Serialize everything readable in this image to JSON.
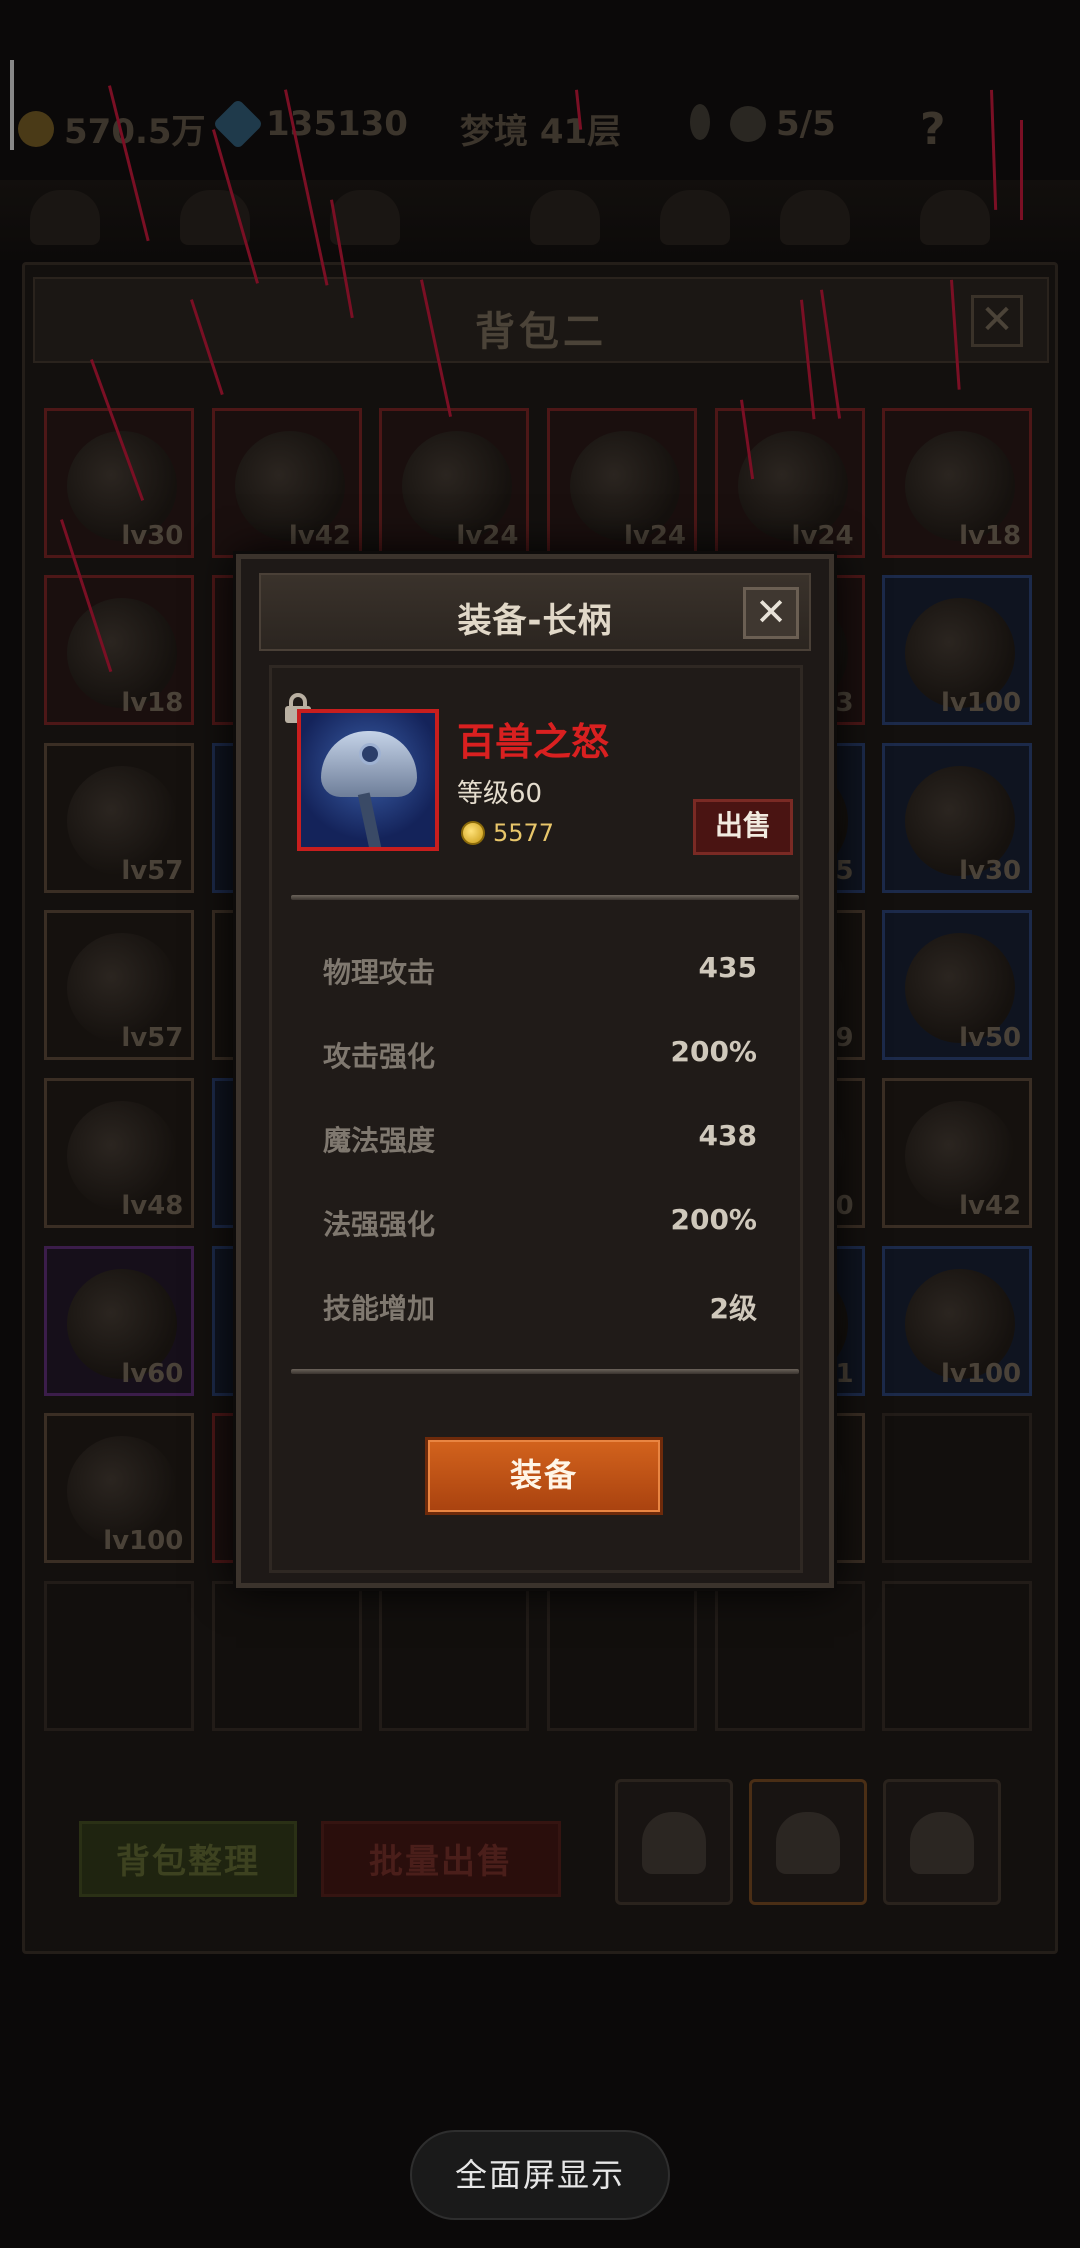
{
  "topbar": {
    "gold": "570.5万",
    "gems": "135130",
    "stage": "梦境 41层",
    "skulls": "5/5",
    "help": "?"
  },
  "bag": {
    "title": "背包二",
    "close": "✕",
    "slot_levels": [
      [
        "lv30",
        "lv42",
        "lv24",
        "lv24",
        "lv24",
        "lv18"
      ],
      [
        "lv18",
        "",
        "",
        "",
        "3",
        "lv100"
      ],
      [
        "lv57",
        "",
        "",
        "",
        "5",
        "lv30"
      ],
      [
        "lv57",
        "",
        "",
        "",
        "9",
        "lv50"
      ],
      [
        "lv48",
        "",
        "",
        "",
        "00",
        "lv42"
      ],
      [
        "lv60",
        "",
        "",
        "",
        "1",
        "lv100"
      ],
      [
        "lv100",
        "",
        "",
        "",
        "",
        ""
      ],
      [
        "",
        "",
        "",
        "",
        "",
        ""
      ]
    ],
    "sort_button": "背包整理",
    "bulk_sell_button": "批量出售"
  },
  "modal": {
    "title": "装备-长柄",
    "close": "✕",
    "item_name": "百兽之怒",
    "item_level": "等级60",
    "item_price": "5577",
    "sell_button": "出售",
    "stats": [
      {
        "label": "物理攻击",
        "value": "435"
      },
      {
        "label": "攻击强化",
        "value": "200%"
      },
      {
        "label": "魔法强度",
        "value": "438"
      },
      {
        "label": "法强强化",
        "value": "200%"
      },
      {
        "label": "技能增加",
        "value": "2级"
      }
    ],
    "equip_button": "装备",
    "name_color": "#d92020"
  },
  "fullscreen_button": "全面屏显示"
}
